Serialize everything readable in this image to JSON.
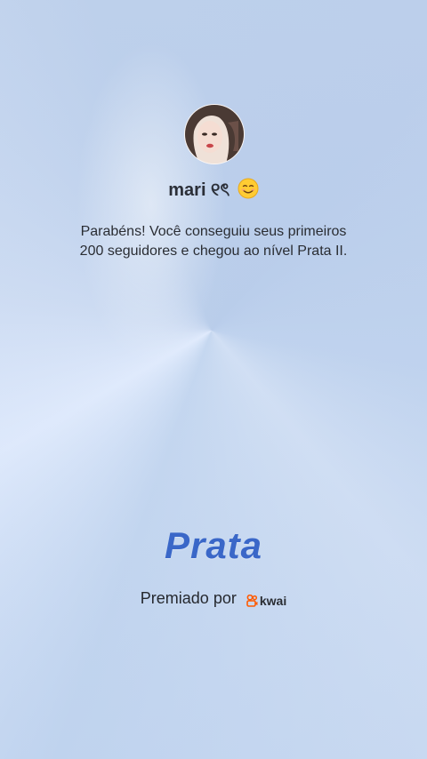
{
  "profile": {
    "username": "mari ୧ৎ",
    "emoji_icon": "smiling-face-emoji"
  },
  "message": {
    "line1": "Parabéns! Você conseguiu seus primeiros",
    "line2": "200 seguidores e chegou ao nível Prata II."
  },
  "level": {
    "title": "Prata",
    "title_color": "#3a67c8"
  },
  "award": {
    "label": "Premiado por",
    "brand": "kwai",
    "brand_icon": "kwai-logo-icon",
    "brand_color": "#ff5a00"
  }
}
